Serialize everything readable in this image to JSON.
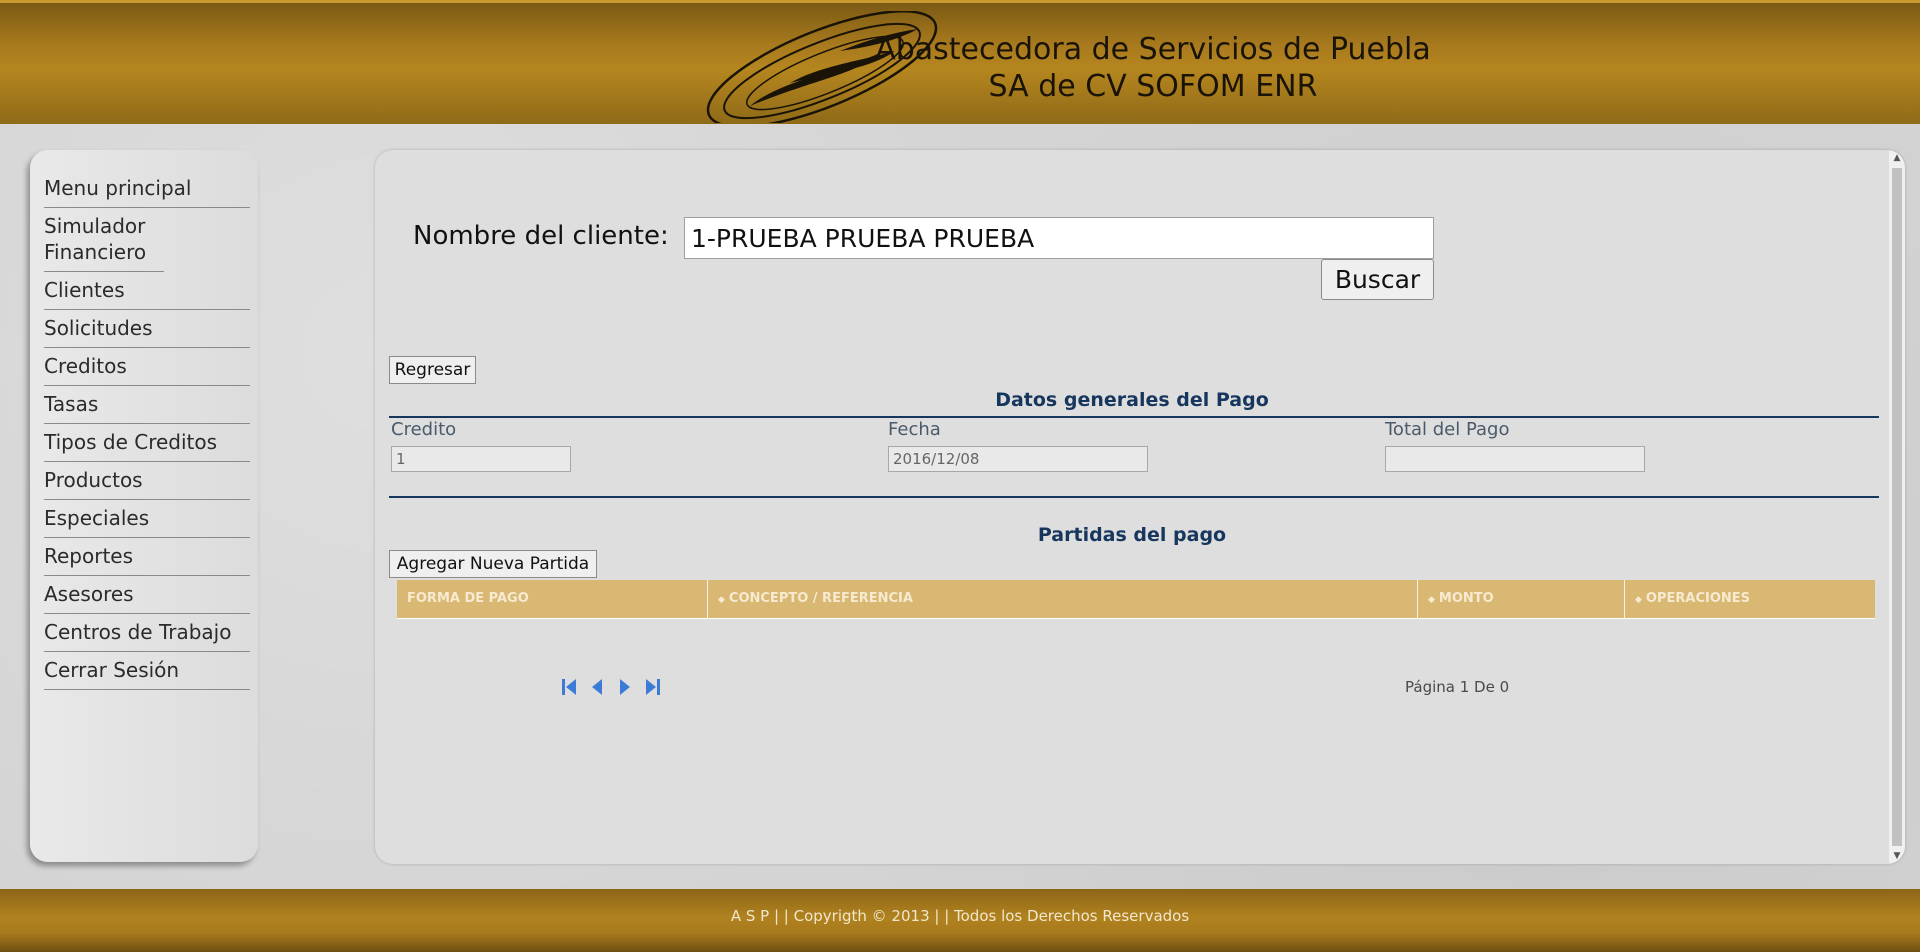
{
  "header": {
    "title_line1": "Abastecedora de Servicios de Puebla",
    "title_line2": "SA de CV SOFOM ENR"
  },
  "sidebar": {
    "items": [
      {
        "label": "Menu principal"
      },
      {
        "label": "Simulador Financiero"
      },
      {
        "label": "Clientes"
      },
      {
        "label": "Solicitudes"
      },
      {
        "label": "Creditos"
      },
      {
        "label": "Tasas"
      },
      {
        "label": "Tipos de Creditos"
      },
      {
        "label": "Productos"
      },
      {
        "label": "Especiales"
      },
      {
        "label": "Reportes"
      },
      {
        "label": "Asesores"
      },
      {
        "label": "Centros de Trabajo"
      },
      {
        "label": "Cerrar Sesión"
      }
    ]
  },
  "search": {
    "label": "Nombre del cliente:",
    "value": "1-PRUEBA PRUEBA PRUEBA",
    "button_label": "Buscar"
  },
  "toolbar": {
    "back_label": "Regresar"
  },
  "payment": {
    "section_title": "Datos generales del Pago",
    "credito_label": "Credito",
    "credito_value": "1",
    "fecha_label": "Fecha",
    "fecha_value": "2016/12/08",
    "total_label": "Total del Pago",
    "total_value": ""
  },
  "partidas": {
    "section_title": "Partidas del pago",
    "add_label": "Agregar Nueva Partida",
    "columns": [
      "FORMA DE PAGO",
      "CONCEPTO / REFERENCIA",
      "MONTO",
      "OPERACIONES"
    ],
    "rows": [],
    "pager_info": "Página 1 De 0"
  },
  "footer": {
    "text": "A S P  | |  Copyrigth © 2013  | |  Todos los Derechos Reservados"
  },
  "colors": {
    "header_gold": "#b5861f",
    "section_navy": "#17365d",
    "grid_header": "#d9b873",
    "pager_blue": "#3d7bd6"
  },
  "icons": {
    "logo": "swirl-logo",
    "pager": [
      "first-page-icon",
      "prev-page-icon",
      "next-page-icon",
      "last-page-icon"
    ]
  }
}
